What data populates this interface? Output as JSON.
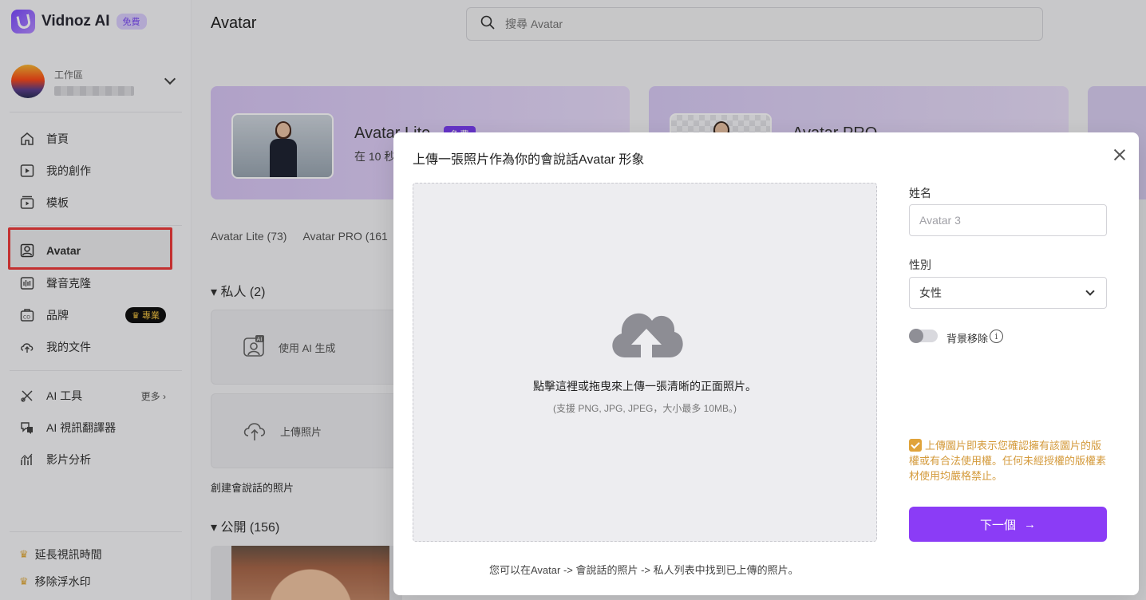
{
  "app": {
    "brand": "Vidnoz AI",
    "brand_badge": "免費"
  },
  "workspace": {
    "label": "工作區"
  },
  "sidebar": {
    "items": [
      {
        "label": "首頁",
        "icon": "home-icon"
      },
      {
        "label": "我的創作",
        "icon": "play-square-icon"
      },
      {
        "label": "模板",
        "icon": "template-icon"
      },
      {
        "label": "Avatar",
        "icon": "avatar-icon"
      },
      {
        "label": "聲音克隆",
        "icon": "waveform-icon"
      },
      {
        "label": "品牌",
        "icon": "brand-kit-icon",
        "badge": "專業"
      },
      {
        "label": "我的文件",
        "icon": "upload-cloud-icon"
      },
      {
        "label": "AI 工具",
        "icon": "tools-icon",
        "more": "更多"
      },
      {
        "label": "AI 視訊翻譯器",
        "icon": "translate-icon"
      },
      {
        "label": "影片分析",
        "icon": "analytics-icon"
      }
    ],
    "bottom": [
      {
        "label": "延長視訊時間",
        "icon": "crown-icon"
      },
      {
        "label": "移除浮水印",
        "icon": "crown-icon"
      }
    ]
  },
  "header": {
    "title": "Avatar",
    "search_placeholder": "搜尋 Avatar"
  },
  "cards": [
    {
      "title": "Avatar Lite",
      "badge": "免費",
      "subtitle": "在 10 秒"
    },
    {
      "title": "Avatar PRO"
    }
  ],
  "tabs": [
    "Avatar Lite (73)",
    "Avatar PRO (161"
  ],
  "sections": {
    "private": "私人 (2)",
    "public": "公開 (156)",
    "tile_ai": "使用 AI 生成",
    "tile_upload": "上傳照片",
    "tile_caption": "創建會說話的照片"
  },
  "modal": {
    "title": "上傳一張照片作為你的會說話Avatar 形象",
    "dropzone_main": "點擊這裡或拖曳來上傳一張清晰的正面照片。",
    "dropzone_sub": "(支援 PNG, JPG, JPEG，大小最多 10MB。)",
    "footer_hint": "您可以在Avatar -> 會說話的照片 -> 私人列表中找到已上傳的照片。",
    "name_label": "姓名",
    "name_placeholder": "Avatar 3",
    "gender_label": "性別",
    "gender_value": "女性",
    "bg_remove_label": "背景移除",
    "bg_remove_on": false,
    "consent_text": "上傳圖片即表示您確認擁有該圖片的版權或有合法使用權。任何未經授權的版權素材使用均嚴格禁止。",
    "consent_checked": true,
    "next_label": "下一個",
    "next_arrow": "→"
  },
  "colors": {
    "accent": "#8b3cf6",
    "consent": "#d49a3b",
    "highlight_border": "#ee3b3b"
  }
}
